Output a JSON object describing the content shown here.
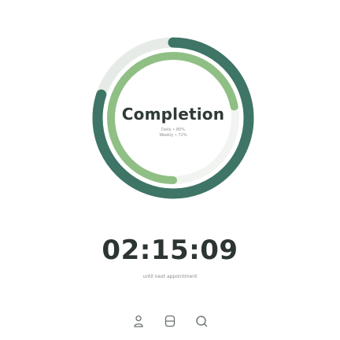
{
  "completion": {
    "title": "Completion",
    "daily_label": "Daily • 80%",
    "weekly_label": "Weekly • 72%",
    "daily_progress": 0.8,
    "weekly_progress": 0.72,
    "outer_ring_color": "#3e7566",
    "inner_ring_color": "#8fbf84",
    "track_color": "#e6ebe7"
  },
  "countdown": {
    "time": "02:15:09",
    "caption": "until next appointment"
  },
  "nav": {
    "items": [
      {
        "icon": "person-icon"
      },
      {
        "icon": "device-icon"
      },
      {
        "icon": "search-icon"
      }
    ],
    "icon_color": "#6b7370"
  }
}
